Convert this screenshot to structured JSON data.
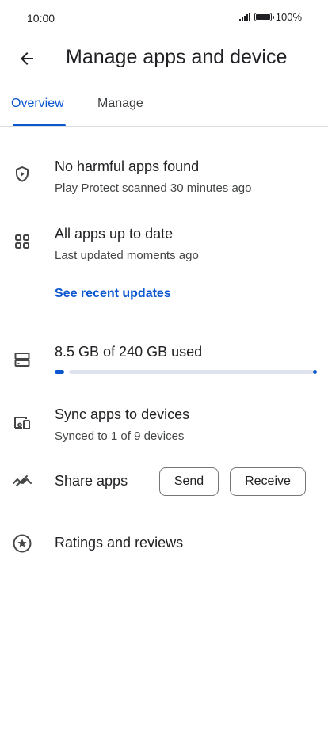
{
  "status_bar": {
    "time": "10:00",
    "battery_text": "100%"
  },
  "header": {
    "title": "Manage apps and device",
    "back_icon": "arrow-back-icon"
  },
  "tabs": [
    {
      "label": "Overview",
      "selected": true
    },
    {
      "label": "Manage",
      "selected": false
    }
  ],
  "protect": {
    "icon": "shield-play-icon",
    "title": "No harmful apps found",
    "subtitle": "Play Protect scanned 30 minutes ago"
  },
  "updates": {
    "icon": "apps-grid-icon",
    "title": "All apps up to date",
    "subtitle": "Last updated moments ago",
    "link": "See recent updates"
  },
  "storage": {
    "icon": "storage-icon",
    "title": "8.5 GB of 240 GB used",
    "used_fraction": 0.035
  },
  "sync": {
    "icon": "devices-icon",
    "title": "Sync apps to devices",
    "subtitle": "Synced to 1 of 9 devices"
  },
  "share": {
    "icon": "share-apps-icon",
    "title": "Share apps",
    "send_label": "Send",
    "receive_label": "Receive"
  },
  "ratings": {
    "icon": "star-circle-icon",
    "title": "Ratings and reviews"
  },
  "colors": {
    "accent": "#0b57d0",
    "text": "#202124",
    "secondary_text": "#444746",
    "track": "#dfe3eb"
  }
}
